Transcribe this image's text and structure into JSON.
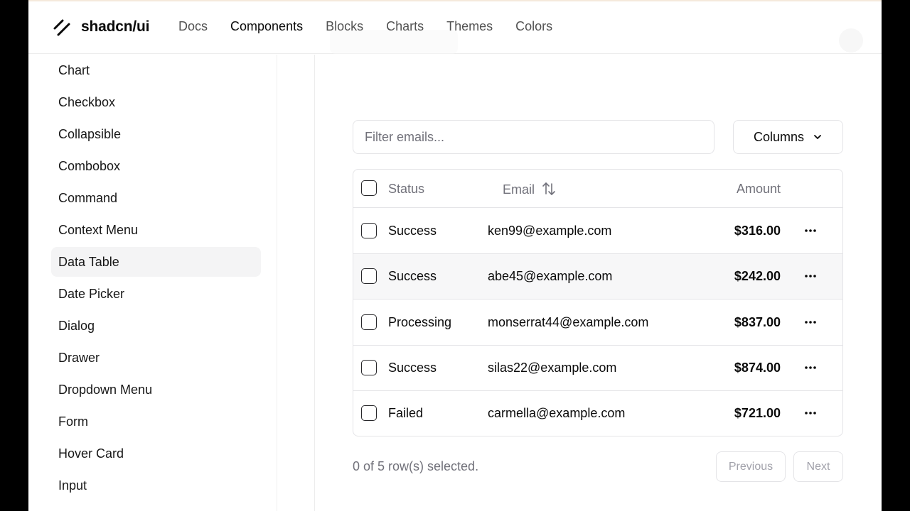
{
  "header": {
    "brand": "shadcn/ui",
    "nav": [
      "Docs",
      "Components",
      "Blocks",
      "Charts",
      "Themes",
      "Colors"
    ],
    "active_nav": "Components"
  },
  "sidebar": {
    "items": [
      "Chart",
      "Checkbox",
      "Collapsible",
      "Combobox",
      "Command",
      "Context Menu",
      "Data Table",
      "Date Picker",
      "Dialog",
      "Drawer",
      "Dropdown Menu",
      "Form",
      "Hover Card",
      "Input"
    ],
    "active": "Data Table"
  },
  "toolbar": {
    "filter_placeholder": "Filter emails...",
    "columns_label": "Columns"
  },
  "table": {
    "headers": {
      "status": "Status",
      "email": "Email",
      "amount": "Amount"
    },
    "rows": [
      {
        "status": "Success",
        "email": "ken99@example.com",
        "amount": "$316.00"
      },
      {
        "status": "Success",
        "email": "abe45@example.com",
        "amount": "$242.00"
      },
      {
        "status": "Processing",
        "email": "monserrat44@example.com",
        "amount": "$837.00"
      },
      {
        "status": "Success",
        "email": "silas22@example.com",
        "amount": "$874.00"
      },
      {
        "status": "Failed",
        "email": "carmella@example.com",
        "amount": "$721.00"
      }
    ]
  },
  "footer": {
    "selection_text": "0 of 5 row(s) selected.",
    "previous_label": "Previous",
    "next_label": "Next"
  }
}
